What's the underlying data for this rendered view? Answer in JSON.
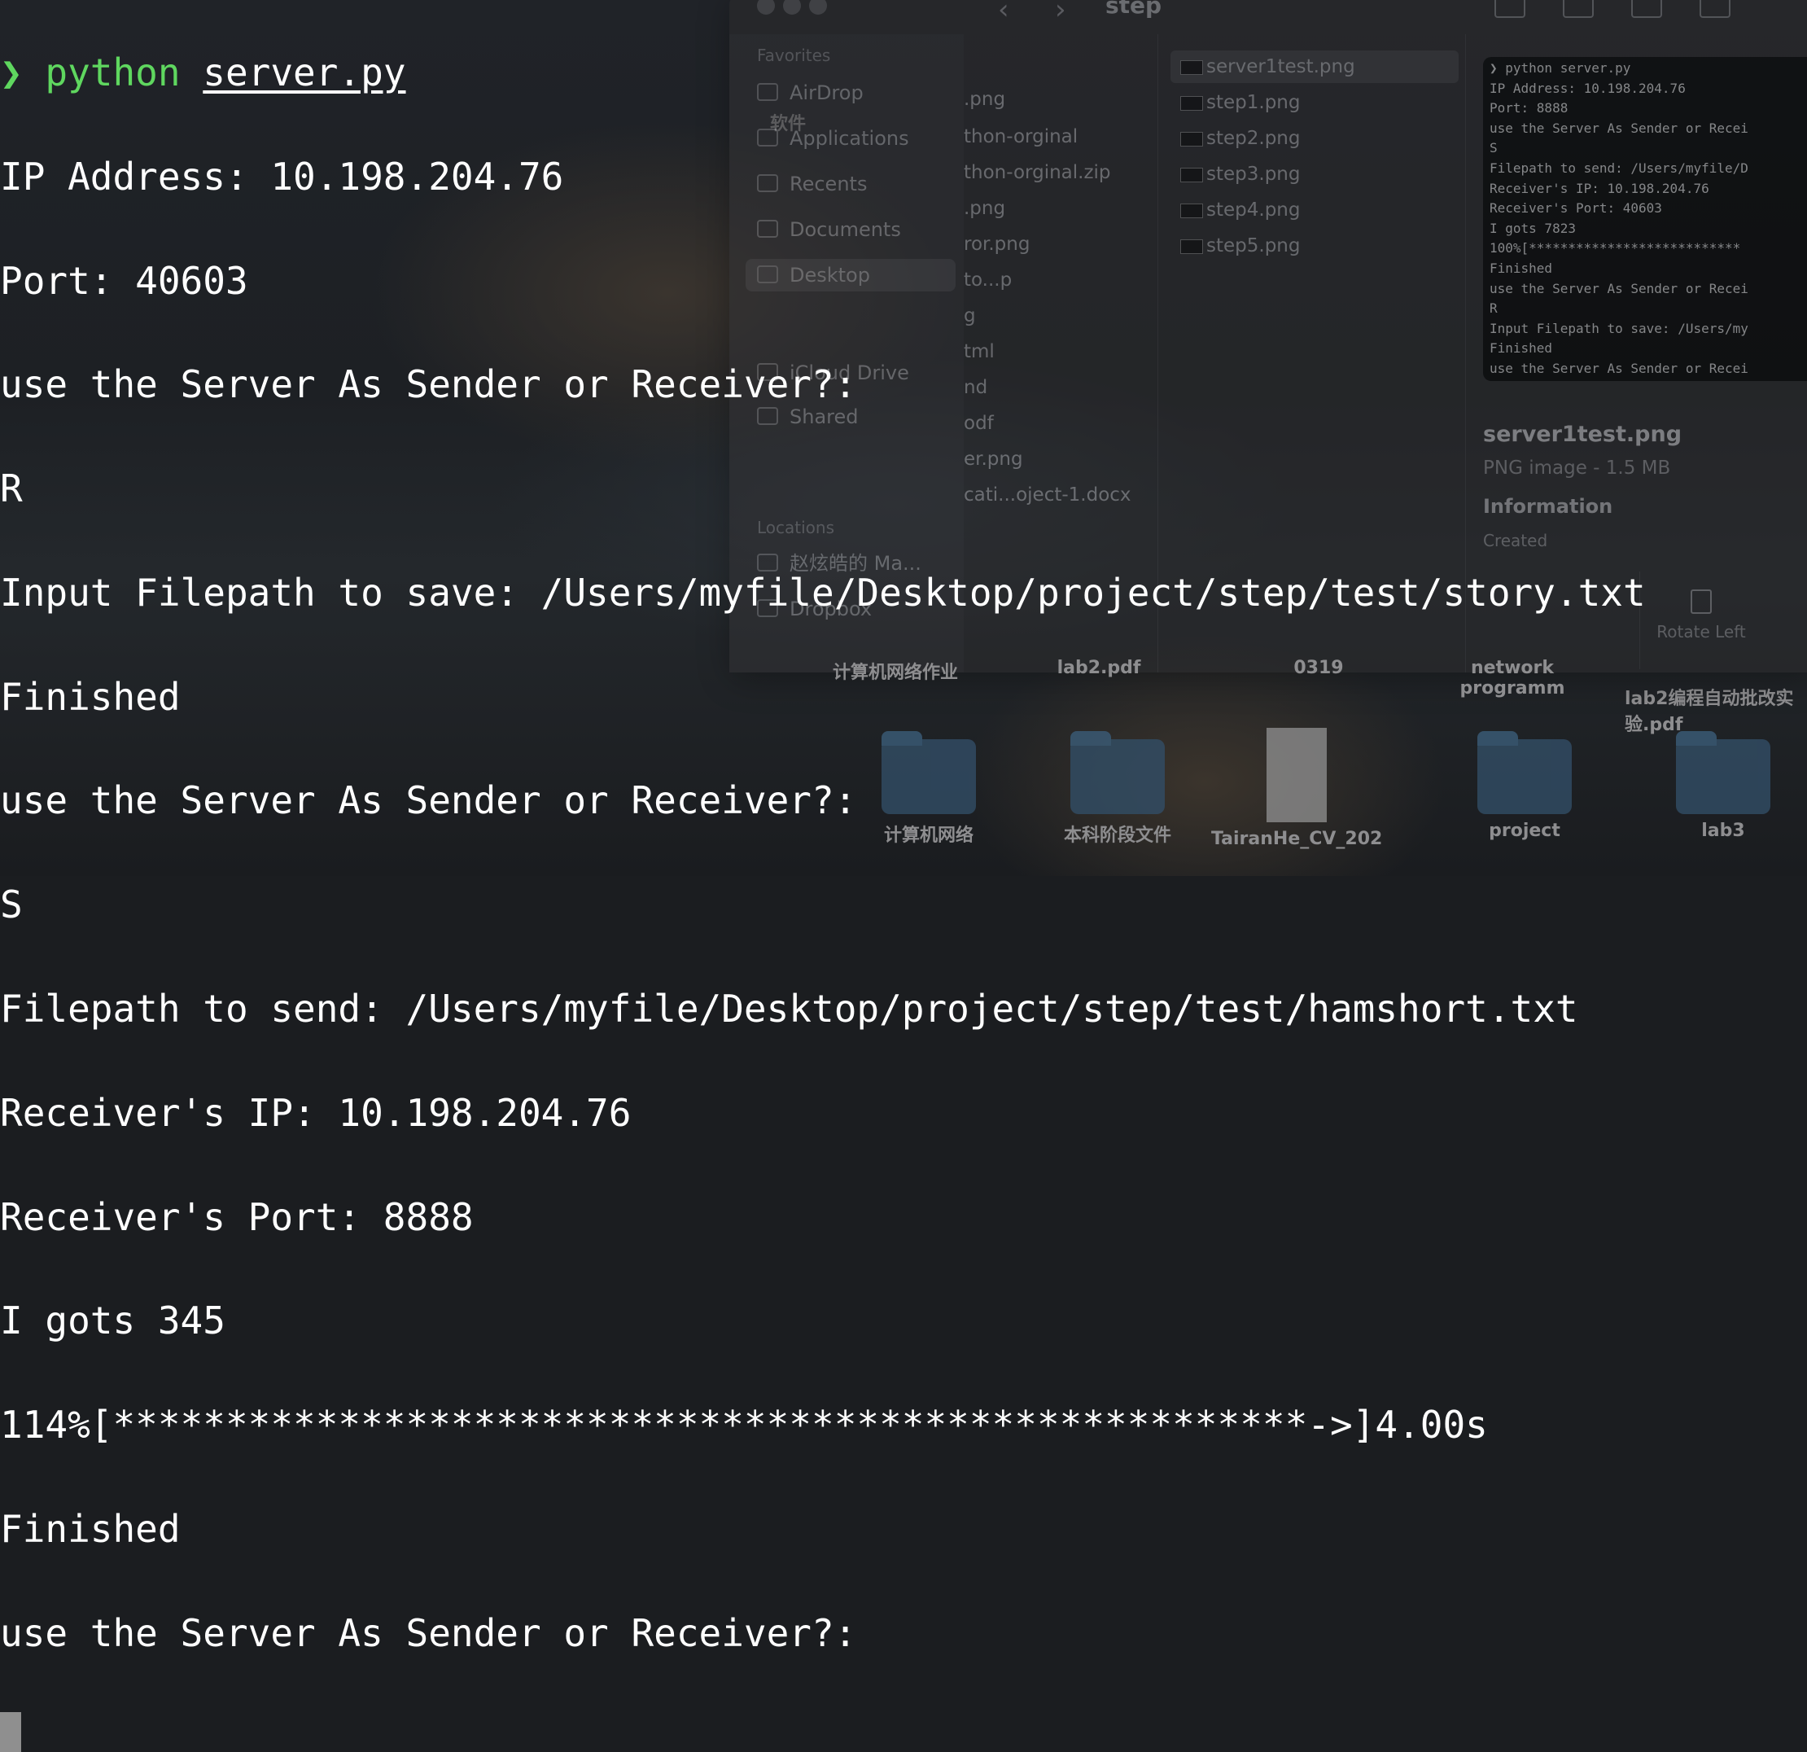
{
  "terminal": {
    "prompt_arrow": "❯",
    "command": "python",
    "command_arg": "server.py",
    "lines": [
      "IP Address: 10.198.204.76",
      "Port: 40603",
      "use the Server As Sender or Receiver?:",
      "R",
      "Input Filepath to save: /Users/myfile/Desktop/project/step/test/story.txt",
      "Finished",
      "use the Server As Sender or Receiver?:",
      "S",
      "Filepath to send: /Users/myfile/Desktop/project/step/test/hamshort.txt",
      "Receiver's IP: 10.198.204.76",
      "Receiver's Port: 8888",
      "I gots 345",
      "114%[*****************************************************->]4.00s",
      "Finished",
      "use the Server As Sender or Receiver?:"
    ]
  },
  "finder": {
    "window_title": "step",
    "sidebar": {
      "favorites_heading": "Favorites",
      "favorites": [
        "AirDrop",
        "Applications",
        "Recents",
        "Documents",
        "Desktop"
      ],
      "icloud": "iCloud Drive",
      "shared": "Shared",
      "locations_heading": "Locations",
      "locations": [
        "赵炫皓的 Ma...",
        "Dropbox"
      ]
    },
    "column1": [
      ".png",
      "thon-orginal",
      "thon-orginal.zip",
      ".png",
      "ror.png",
      "to...p",
      "g",
      "tml",
      "nd",
      "odf",
      "er.png",
      "cati...oject-1.docx"
    ],
    "column2": [
      "server1test.png",
      "step1.png",
      "step2.png",
      "step3.png",
      "step4.png",
      "step5.png"
    ],
    "preview": {
      "lines": [
        "❯ python server.py",
        "IP Address: 10.198.204.76",
        "Port: 8888",
        "use the Server As Sender or Recei",
        "S",
        "Filepath to send: /Users/myfile/D",
        "Receiver's IP: 10.198.204.76",
        "Receiver's Port: 40603",
        "I gots 7823",
        "100%[***************************",
        "Finished",
        "use the Server As Sender or Recei",
        "R",
        "Input Filepath to save: /Users/my",
        "Finished",
        "use the Server As Sender or Recei"
      ],
      "name": "server1test.png",
      "meta": "PNG image - 1.5 MB",
      "info_heading": "Information",
      "created_label": "Created",
      "rotate_label": "Rotate Left"
    }
  },
  "desktop": {
    "top_labels": [
      "软件",
      "计算机网络作业",
      "lab2.pdf",
      "0319",
      "network programm",
      "lab2编程自动批改实验.pdf"
    ],
    "icons": [
      {
        "label": "计算机网络",
        "kind": "folder"
      },
      {
        "label": "本科阶段文件",
        "kind": "folder"
      },
      {
        "label": "TairanHe_CV_202",
        "kind": "doc"
      },
      {
        "label": "project",
        "kind": "folder"
      },
      {
        "label": "lab3",
        "kind": "folder"
      }
    ]
  }
}
